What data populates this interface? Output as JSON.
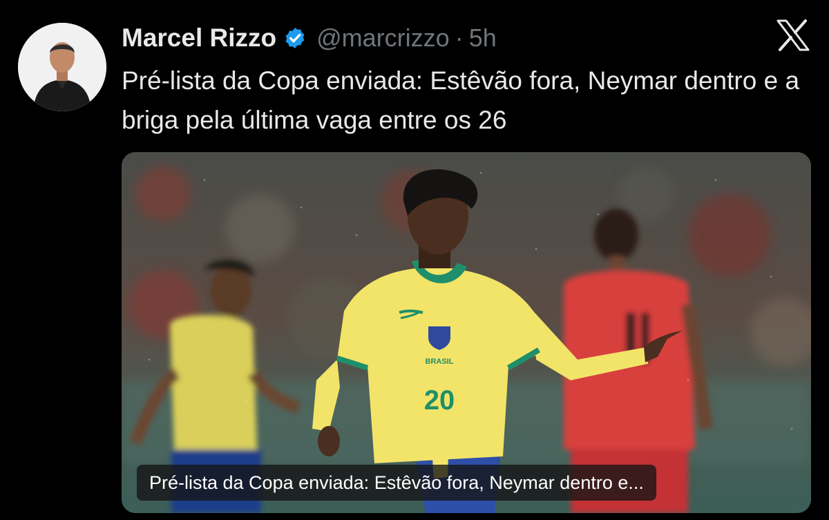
{
  "tweet": {
    "author_name": "Marcel Rizzo",
    "handle": "@marcrizzo",
    "separator": "·",
    "time": "5h",
    "text": "Pré-lista da Copa enviada: Estêvão fora, Neymar dentro e a briga pela última vaga entre os 26"
  },
  "card": {
    "caption": "Pré-lista da Copa enviada: Estêvão fora, Neymar dentro e...",
    "jersey_text": "BRASIL",
    "jersey_number": "20"
  },
  "icons": {
    "verified": "verified-badge-icon",
    "logo": "x-logo-icon"
  },
  "colors": {
    "background": "#000000",
    "primary_text": "#e7e9ea",
    "secondary_text": "#71767b",
    "verified": "#1d9bf0"
  }
}
